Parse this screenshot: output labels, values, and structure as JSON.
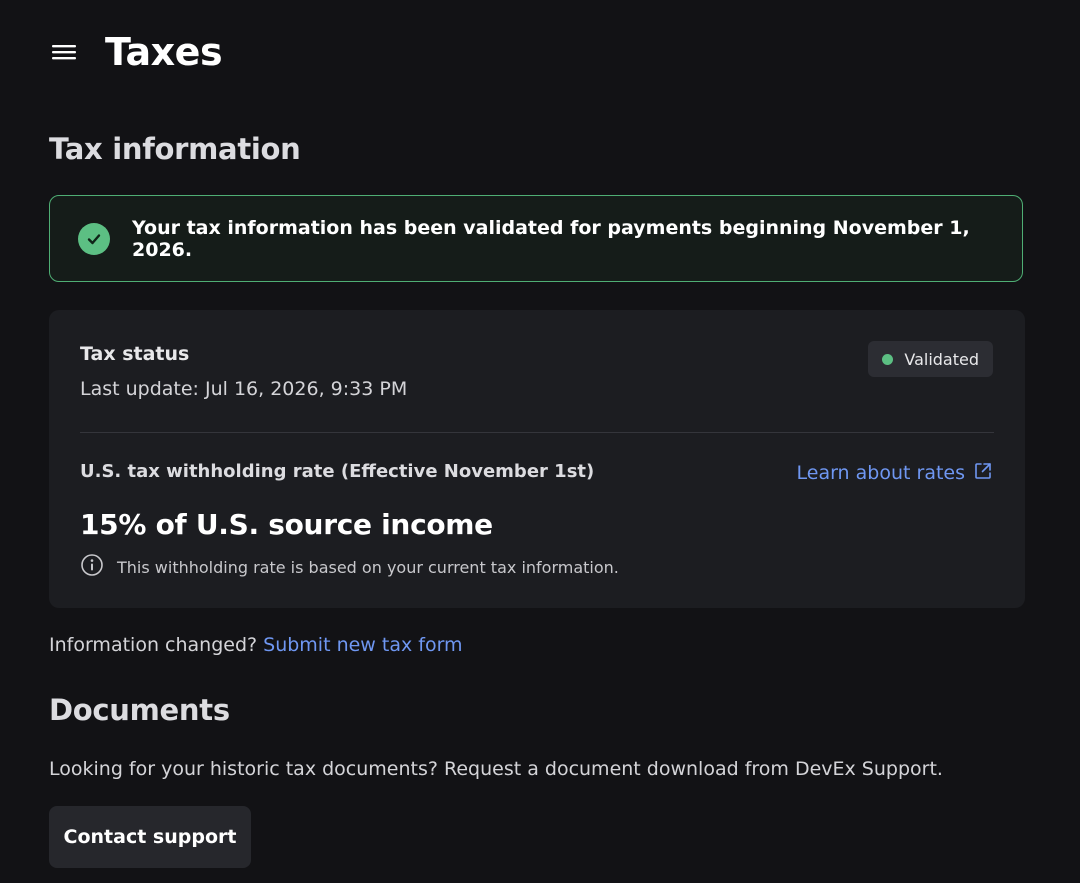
{
  "header": {
    "title": "Taxes",
    "menu_icon": "hamburger-menu-icon"
  },
  "tax_information": {
    "section_title": "Tax information",
    "banner": {
      "icon": "check-circle-icon",
      "message": "Your tax information has been validated for payments beginning November 1, 2026."
    },
    "status": {
      "label": "Tax status",
      "last_update": "Last update: Jul 16, 2026, 9:33 PM",
      "badge": "Validated"
    },
    "withholding": {
      "label": "U.S. tax withholding rate (Effective November 1st)",
      "learn_link": "Learn about rates",
      "learn_icon": "external-link-icon",
      "rate": "15% of U.S. source income",
      "note_icon": "info-icon",
      "note": "This withholding rate is based on your current tax information."
    },
    "changed_prompt": "Information changed?",
    "changed_link": "Submit new tax form"
  },
  "documents": {
    "section_title": "Documents",
    "description": "Looking for your historic tax documents? Request a document download from DevEx Support.",
    "contact_button": "Contact support"
  },
  "colors": {
    "background": "#121215",
    "card": "#1c1d21",
    "success": "#5cbf83",
    "link": "#6f97f2"
  }
}
